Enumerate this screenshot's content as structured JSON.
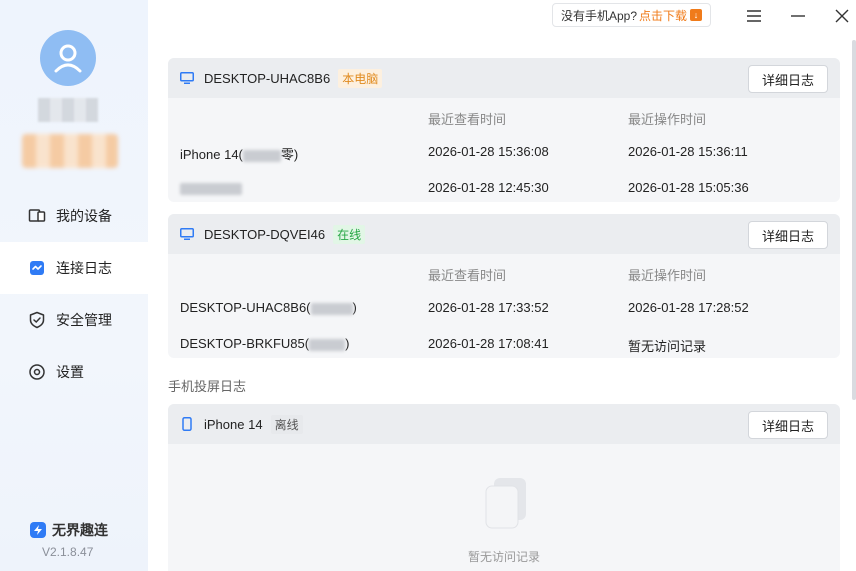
{
  "sidebar": {
    "items": [
      {
        "label": "我的设备",
        "icon": "devices-icon"
      },
      {
        "label": "连接日志",
        "icon": "log-icon"
      },
      {
        "label": "安全管理",
        "icon": "shield-icon"
      },
      {
        "label": "设置",
        "icon": "gear-icon"
      }
    ],
    "active_index": 1,
    "brand": "无界趣连",
    "version": "V2.1.8.47"
  },
  "topbar": {
    "promo_text": "没有手机App?",
    "promo_link": "点击下载"
  },
  "colors": {
    "accent": "#2f7bf5",
    "orange": "#f07b1a",
    "green": "#27a745"
  },
  "cards": [
    {
      "device": "DESKTOP-UHAC8B6",
      "tag": "本电脑",
      "button": "详细日志",
      "col_view": "最近查看时间",
      "col_op": "最近操作时间",
      "rows": [
        {
          "name_prefix": "iPhone 14(",
          "name_suffix": "零)",
          "view": "2026-01-28 15:36:08",
          "op": "2026-01-28 15:36:11"
        },
        {
          "name_prefix": "",
          "name_suffix": "",
          "view": "2026-01-28 12:45:30",
          "op": "2026-01-28 15:05:36"
        }
      ]
    },
    {
      "device": "DESKTOP-DQVEI46",
      "tag": "在线",
      "button": "详细日志",
      "col_view": "最近查看时间",
      "col_op": "最近操作时间",
      "rows": [
        {
          "name_prefix": "DESKTOP-UHAC8B6(",
          "name_suffix": ")",
          "view": "2026-01-28 17:33:52",
          "op": "2026-01-28 17:28:52"
        },
        {
          "name_prefix": "DESKTOP-BRKFU85(",
          "name_suffix": ")",
          "view": "2026-01-28 17:08:41",
          "op": "暂无访问记录"
        }
      ]
    }
  ],
  "mobile_section": {
    "title": "手机投屏日志",
    "device": "iPhone 14",
    "tag": "离线",
    "button": "详细日志",
    "empty_text": "暂无访问记录"
  }
}
